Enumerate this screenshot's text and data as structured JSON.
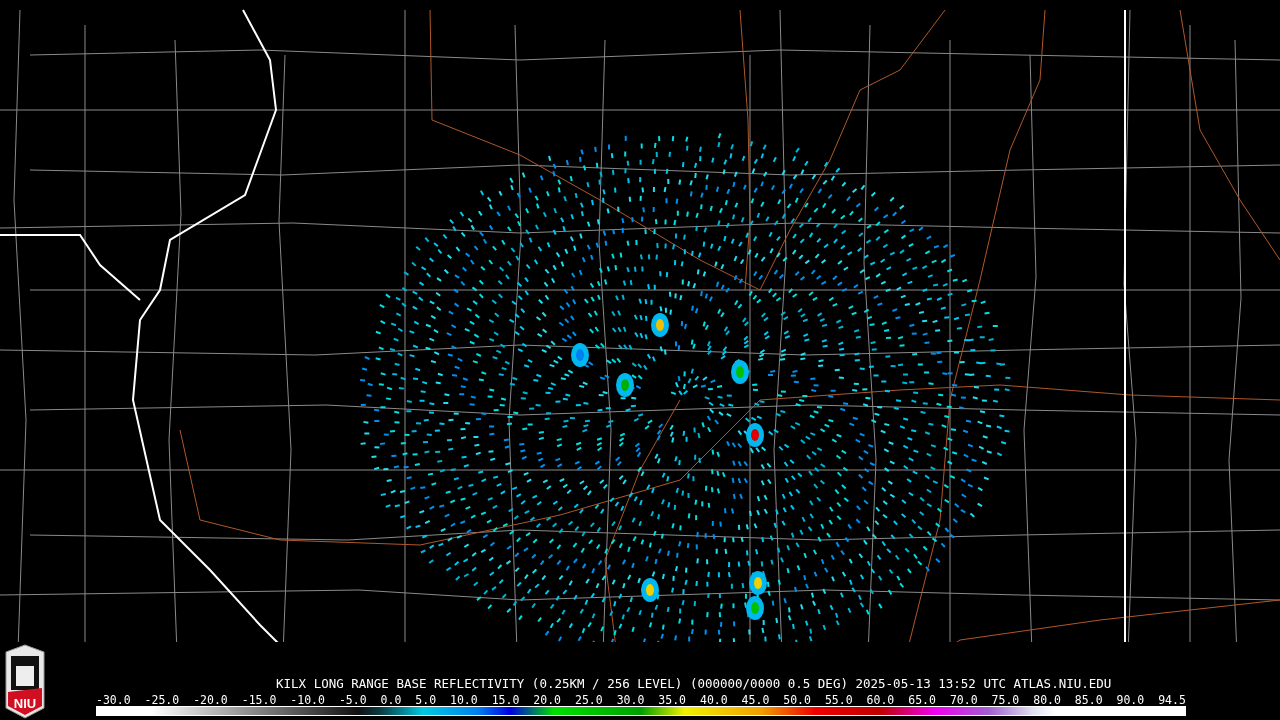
{
  "logo": {
    "text": "NIU"
  },
  "caption": "KILX LONG RANGE BASE REFLECTIVITY (0.25KM / 256 LEVEL) (000000/0000 0.5 DEG) 2025-05-13 13:52 UTC  ATLAS.NIU.EDU",
  "legend": {
    "ticks": [
      "-30.0",
      "-25.0",
      "-20.0",
      "-15.0",
      "-10.0",
      "-5.0",
      "0.0",
      "5.0",
      "10.0",
      "15.0",
      "20.0",
      "25.0",
      "30.0",
      "35.0",
      "40.0",
      "45.0",
      "50.0",
      "55.0",
      "60.0",
      "65.0",
      "70.0",
      "75.0",
      "80.0",
      "85.0",
      "90.0",
      "94.5"
    ]
  }
}
